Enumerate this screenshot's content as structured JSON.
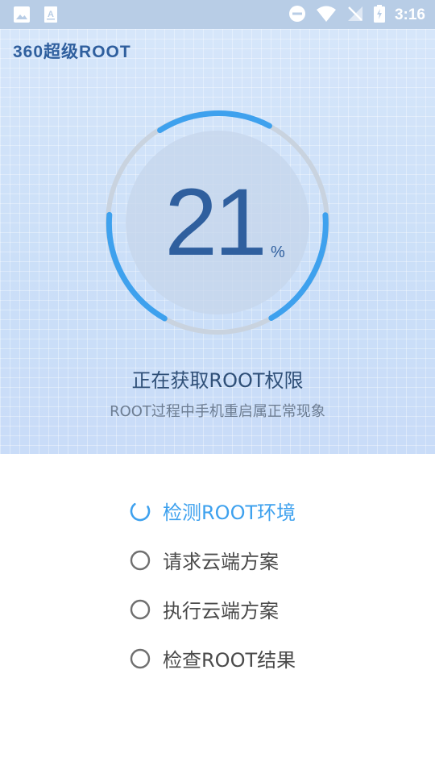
{
  "status_bar": {
    "time": "3:16",
    "left_icons": [
      "image-icon",
      "text-a-icon"
    ],
    "right_icons": [
      "do-not-disturb-icon",
      "wifi-icon",
      "no-signal-icon",
      "battery-charging-icon"
    ]
  },
  "header": {
    "logo_text": "360超级ROOT"
  },
  "progress": {
    "value": "21",
    "unit": "%",
    "fraction": 0.21
  },
  "hero": {
    "title": "正在获取ROOT权限",
    "subtitle": "ROOT过程中手机重启属正常现象"
  },
  "steps": [
    {
      "label": "检测ROOT环境",
      "state": "in-progress"
    },
    {
      "label": "请求云端方案",
      "state": "pending"
    },
    {
      "label": "执行云端方案",
      "state": "pending"
    },
    {
      "label": "检查ROOT结果",
      "state": "pending"
    }
  ],
  "colors": {
    "accent": "#3ea1ee",
    "title": "#2f5f9e",
    "pending_icon": "#6f6f6f"
  }
}
